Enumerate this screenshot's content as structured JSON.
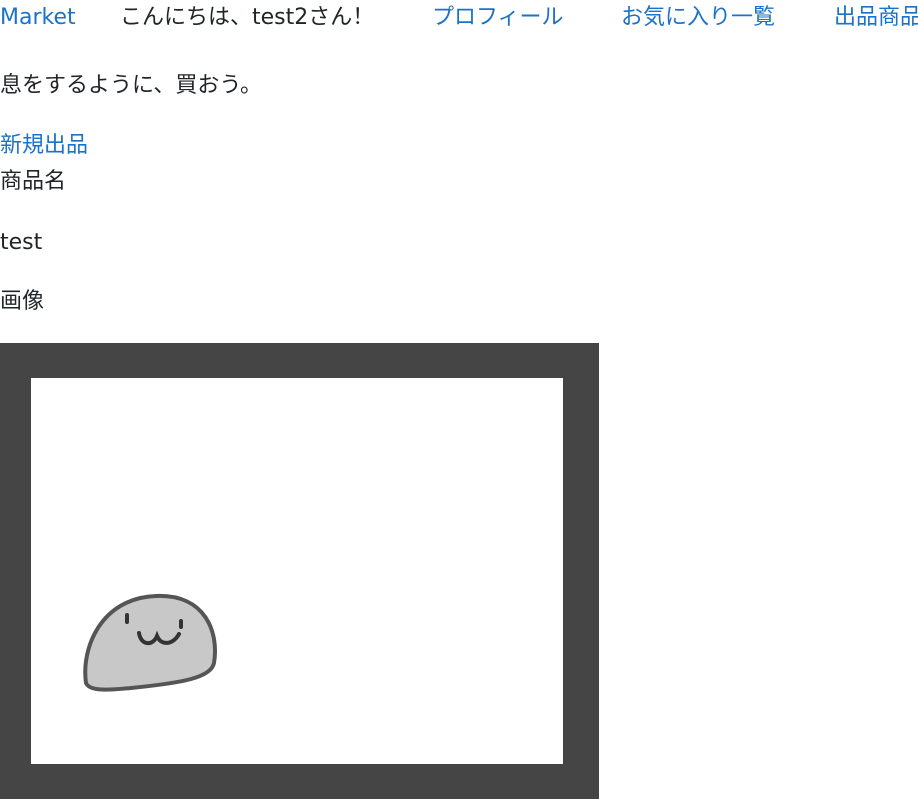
{
  "nav": {
    "brand": "Market",
    "greeting": "こんにちは、test2さん！",
    "profile": "プロフィール",
    "favorites": "お気に入り一覧",
    "listed_items": "出品商品"
  },
  "tagline": "息をするように、買おう。",
  "new_listing_link": "新規出品",
  "product": {
    "name_label": "商品名",
    "name_value": "test",
    "image_label": "画像",
    "image_icon": "blob-face-drawing"
  },
  "colors": {
    "link": "#1a73c8",
    "text": "#212529",
    "image_frame": "#454545"
  }
}
